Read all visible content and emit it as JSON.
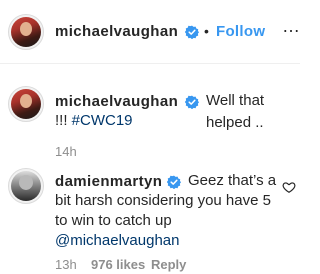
{
  "header": {
    "username": "michaelvaughan",
    "separator": "•",
    "follow_label": "Follow",
    "more_label": "…"
  },
  "caption": {
    "username": "michaelvaughan",
    "text": "Well that helped ..",
    "text_line2": "!!! ",
    "hashtag": "#CWC19",
    "time": "14h"
  },
  "comment": {
    "username": "damienmartyn",
    "text_line1": "Geez that’s a",
    "text_line2": "bit harsh considering you have 5",
    "text_line3": "to win to catch up",
    "mention": "@michaelvaughan",
    "time": "13h",
    "likes": "976 likes",
    "reply_label": "Reply"
  },
  "colors": {
    "accent": "#3897f0",
    "verified": "#3897f0",
    "link": "#00376b",
    "muted": "#8e8e8e"
  },
  "icons": {
    "verified": "verified-badge-icon",
    "like": "heart-outline-icon"
  }
}
